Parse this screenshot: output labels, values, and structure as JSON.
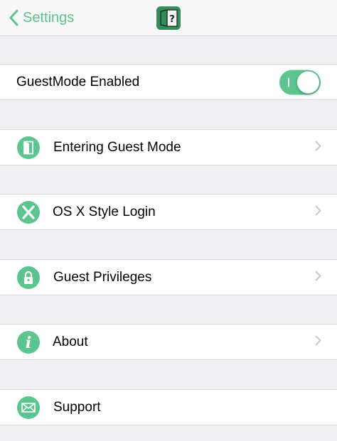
{
  "navbar": {
    "back_label": "Settings",
    "app_icon": "guest-door-app-icon"
  },
  "toggle_row": {
    "label": "GuestMode Enabled",
    "state": "on",
    "accent_color": "#5cc58f"
  },
  "menu": [
    {
      "label": "Entering Guest Mode",
      "icon": "door-icon",
      "has_chevron": true
    },
    {
      "label": "OS X Style Login",
      "icon": "x-logo-icon",
      "has_chevron": true
    },
    {
      "label": "Guest Privileges",
      "icon": "lock-icon",
      "has_chevron": true
    },
    {
      "label": "About",
      "icon": "info-icon",
      "has_chevron": true
    },
    {
      "label": "Support",
      "icon": "mail-icon",
      "has_chevron": false
    }
  ],
  "colors": {
    "accent": "#5cc58f",
    "background": "#efeff4",
    "chevron": "#c7c7cc"
  }
}
